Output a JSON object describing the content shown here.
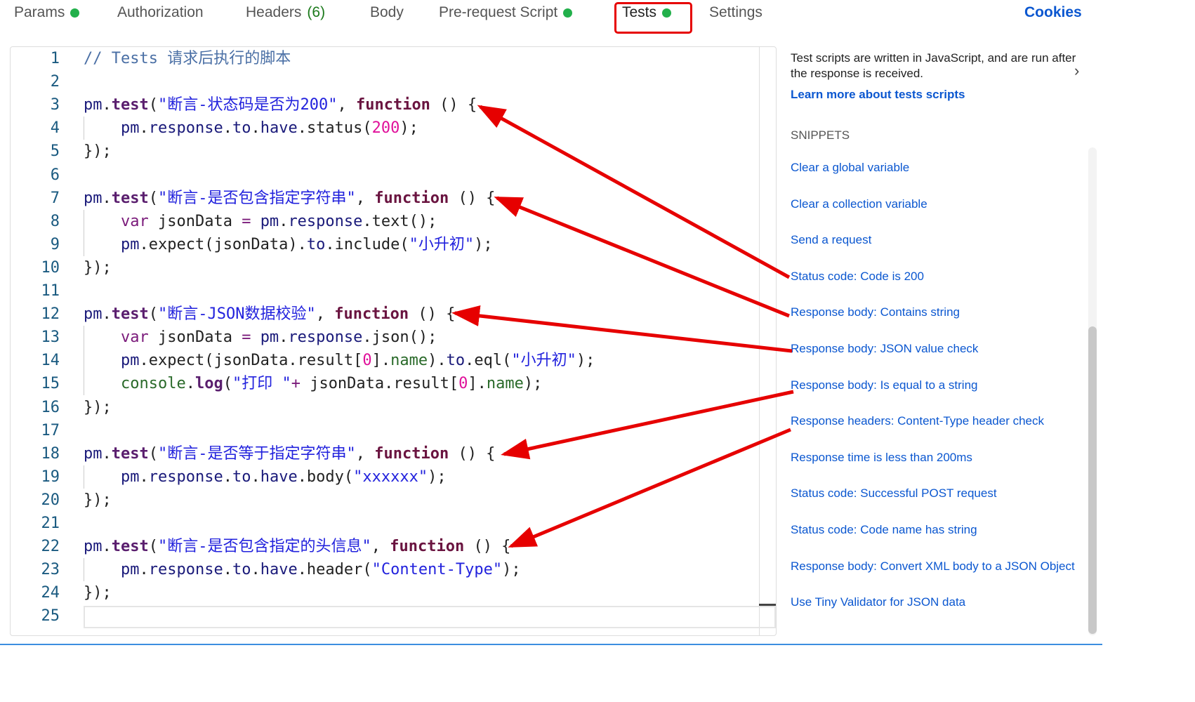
{
  "tabs": [
    {
      "label": "Params",
      "dot": true
    },
    {
      "label": "Authorization"
    },
    {
      "label": "Headers",
      "count": "(6)"
    },
    {
      "label": "Body"
    },
    {
      "label": "Pre-request Script",
      "dot": true
    },
    {
      "label": "Tests",
      "dot": true,
      "active": true
    },
    {
      "label": "Settings"
    }
  ],
  "cookies": "Cookies",
  "editor": {
    "lines": [
      [
        [
          "cm",
          "// Tests 请求后执行的脚本"
        ]
      ],
      [],
      [
        [
          "obj",
          "pm"
        ],
        [
          "pn",
          "."
        ],
        [
          "fn",
          "test"
        ],
        [
          "pn",
          "("
        ],
        [
          "str",
          "\"断言-状态码是否为200\""
        ],
        [
          "pn",
          ", "
        ],
        [
          "kw",
          "function"
        ],
        [
          "pn",
          " () {"
        ]
      ],
      [
        [
          "pn",
          "    "
        ],
        [
          "obj",
          "pm"
        ],
        [
          "pn",
          "."
        ],
        [
          "prop",
          "response"
        ],
        [
          "pn",
          "."
        ],
        [
          "prop",
          "to"
        ],
        [
          "pn",
          "."
        ],
        [
          "prop",
          "have"
        ],
        [
          "pn",
          "."
        ],
        [
          "pn",
          "status("
        ],
        [
          "num",
          "200"
        ],
        [
          "pn",
          ");"
        ]
      ],
      [
        [
          "pn",
          "});"
        ]
      ],
      [],
      [
        [
          "obj",
          "pm"
        ],
        [
          "pn",
          "."
        ],
        [
          "fn",
          "test"
        ],
        [
          "pn",
          "("
        ],
        [
          "str",
          "\"断言-是否包含指定字符串\""
        ],
        [
          "pn",
          ", "
        ],
        [
          "kw",
          "function"
        ],
        [
          "pn",
          " () {"
        ]
      ],
      [
        [
          "pn",
          "    "
        ],
        [
          "var",
          "var"
        ],
        [
          "pn",
          " jsonData "
        ],
        [
          "var",
          "="
        ],
        [
          "pn",
          " "
        ],
        [
          "obj",
          "pm"
        ],
        [
          "pn",
          "."
        ],
        [
          "prop",
          "response"
        ],
        [
          "pn",
          ".text();"
        ]
      ],
      [
        [
          "pn",
          "    "
        ],
        [
          "obj",
          "pm"
        ],
        [
          "pn",
          ".expect(jsonData)."
        ],
        [
          "prop",
          "to"
        ],
        [
          "pn",
          ".include("
        ],
        [
          "str",
          "\"小升初\""
        ],
        [
          "pn",
          ");"
        ]
      ],
      [
        [
          "pn",
          "});"
        ]
      ],
      [],
      [
        [
          "obj",
          "pm"
        ],
        [
          "pn",
          "."
        ],
        [
          "fn",
          "test"
        ],
        [
          "pn",
          "("
        ],
        [
          "str",
          "\"断言-JSON数据校验\""
        ],
        [
          "pn",
          ", "
        ],
        [
          "kw",
          "function"
        ],
        [
          "pn",
          " () {"
        ]
      ],
      [
        [
          "pn",
          "    "
        ],
        [
          "var",
          "var"
        ],
        [
          "pn",
          " jsonData "
        ],
        [
          "var",
          "="
        ],
        [
          "pn",
          " "
        ],
        [
          "obj",
          "pm"
        ],
        [
          "pn",
          "."
        ],
        [
          "prop",
          "response"
        ],
        [
          "pn",
          ".json();"
        ]
      ],
      [
        [
          "pn",
          "    "
        ],
        [
          "obj",
          "pm"
        ],
        [
          "pn",
          ".expect(jsonData.result["
        ],
        [
          "num",
          "0"
        ],
        [
          "pn",
          "]."
        ],
        [
          "grn",
          "name"
        ],
        [
          "pn",
          ")."
        ],
        [
          "prop",
          "to"
        ],
        [
          "pn",
          ".eql("
        ],
        [
          "str",
          "\"小升初\""
        ],
        [
          "pn",
          ");"
        ]
      ],
      [
        [
          "pn",
          "    "
        ],
        [
          "grn",
          "console"
        ],
        [
          "pn",
          "."
        ],
        [
          "fn",
          "log"
        ],
        [
          "pn",
          "("
        ],
        [
          "str",
          "\"打印 \""
        ],
        [
          "var",
          "+"
        ],
        [
          "pn",
          " jsonData.result["
        ],
        [
          "num",
          "0"
        ],
        [
          "pn",
          "]."
        ],
        [
          "grn",
          "name"
        ],
        [
          "pn",
          ");"
        ]
      ],
      [
        [
          "pn",
          "});"
        ]
      ],
      [],
      [
        [
          "obj",
          "pm"
        ],
        [
          "pn",
          "."
        ],
        [
          "fn",
          "test"
        ],
        [
          "pn",
          "("
        ],
        [
          "str",
          "\"断言-是否等于指定字符串\""
        ],
        [
          "pn",
          ", "
        ],
        [
          "kw",
          "function"
        ],
        [
          "pn",
          " () {"
        ]
      ],
      [
        [
          "pn",
          "    "
        ],
        [
          "obj",
          "pm"
        ],
        [
          "pn",
          "."
        ],
        [
          "prop",
          "response"
        ],
        [
          "pn",
          "."
        ],
        [
          "prop",
          "to"
        ],
        [
          "pn",
          "."
        ],
        [
          "prop",
          "have"
        ],
        [
          "pn",
          ".body("
        ],
        [
          "str",
          "\"xxxxxx\""
        ],
        [
          "pn",
          ");"
        ]
      ],
      [
        [
          "pn",
          "});"
        ]
      ],
      [],
      [
        [
          "obj",
          "pm"
        ],
        [
          "pn",
          "."
        ],
        [
          "fn",
          "test"
        ],
        [
          "pn",
          "("
        ],
        [
          "str",
          "\"断言-是否包含指定的头信息\""
        ],
        [
          "pn",
          ", "
        ],
        [
          "kw",
          "function"
        ],
        [
          "pn",
          " () {"
        ]
      ],
      [
        [
          "pn",
          "    "
        ],
        [
          "obj",
          "pm"
        ],
        [
          "pn",
          "."
        ],
        [
          "prop",
          "response"
        ],
        [
          "pn",
          "."
        ],
        [
          "prop",
          "to"
        ],
        [
          "pn",
          "."
        ],
        [
          "prop",
          "have"
        ],
        [
          "pn",
          ".header("
        ],
        [
          "str",
          "\"Content-Type\""
        ],
        [
          "pn",
          ");"
        ]
      ],
      [
        [
          "pn",
          "});"
        ]
      ],
      []
    ]
  },
  "side": {
    "description": "Test scripts are written in JavaScript, and are run after the response is received.",
    "learn_more": "Learn more about tests scripts",
    "snippets_heading": "SNIPPETS",
    "snippets": [
      "Clear a global variable",
      "Clear a collection variable",
      "Send a request",
      "Status code: Code is 200",
      "Response body: Contains string",
      "Response body: JSON value check",
      "Response body: Is equal to a string",
      "Response headers: Content-Type header check",
      "Response time is less than 200ms",
      "Status code: Successful POST request",
      "Status code: Code name has string",
      "Response body: Convert XML body to a JSON Object",
      "Use Tiny Validator for JSON data"
    ]
  },
  "colors": {
    "accent": "#0b57d0",
    "dot": "#22b04b",
    "annotation": "#e60000"
  }
}
